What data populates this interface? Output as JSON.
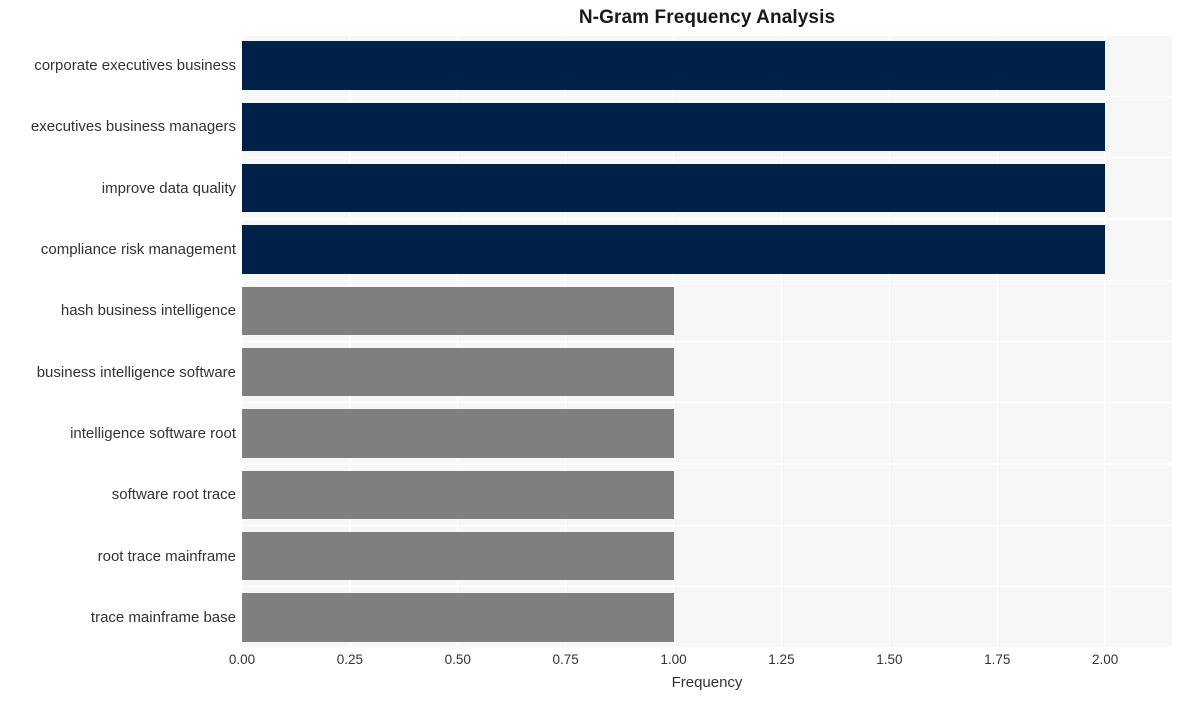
{
  "chart_data": {
    "type": "bar",
    "orientation": "horizontal",
    "title": "N-Gram Frequency Analysis",
    "xlabel": "Frequency",
    "ylabel": "",
    "categories": [
      "corporate executives business",
      "executives business managers",
      "improve data quality",
      "compliance risk management",
      "hash business intelligence",
      "business intelligence software",
      "intelligence software root",
      "software root trace",
      "root trace mainframe",
      "trace mainframe base"
    ],
    "values": [
      2,
      2,
      2,
      2,
      1,
      1,
      1,
      1,
      1,
      1
    ],
    "bar_colors": [
      "#002147",
      "#002147",
      "#002147",
      "#002147",
      "#7f7f7f",
      "#7f7f7f",
      "#7f7f7f",
      "#7f7f7f",
      "#7f7f7f",
      "#7f7f7f"
    ],
    "xlim": [
      0,
      2.155
    ],
    "xticks": [
      0,
      0.25,
      0.5,
      0.75,
      1,
      1.25,
      1.5,
      1.75,
      2
    ],
    "xtick_labels": [
      "0.00",
      "0.25",
      "0.50",
      "0.75",
      "1.00",
      "1.25",
      "1.50",
      "1.75",
      "2.00"
    ],
    "grid": true,
    "grid_color": "#ffffff",
    "legend": null,
    "plot_background": "#f7f7f7",
    "figure_background": "#ffffff",
    "text_color": "#333333",
    "title_color": "#1a1a1a"
  }
}
